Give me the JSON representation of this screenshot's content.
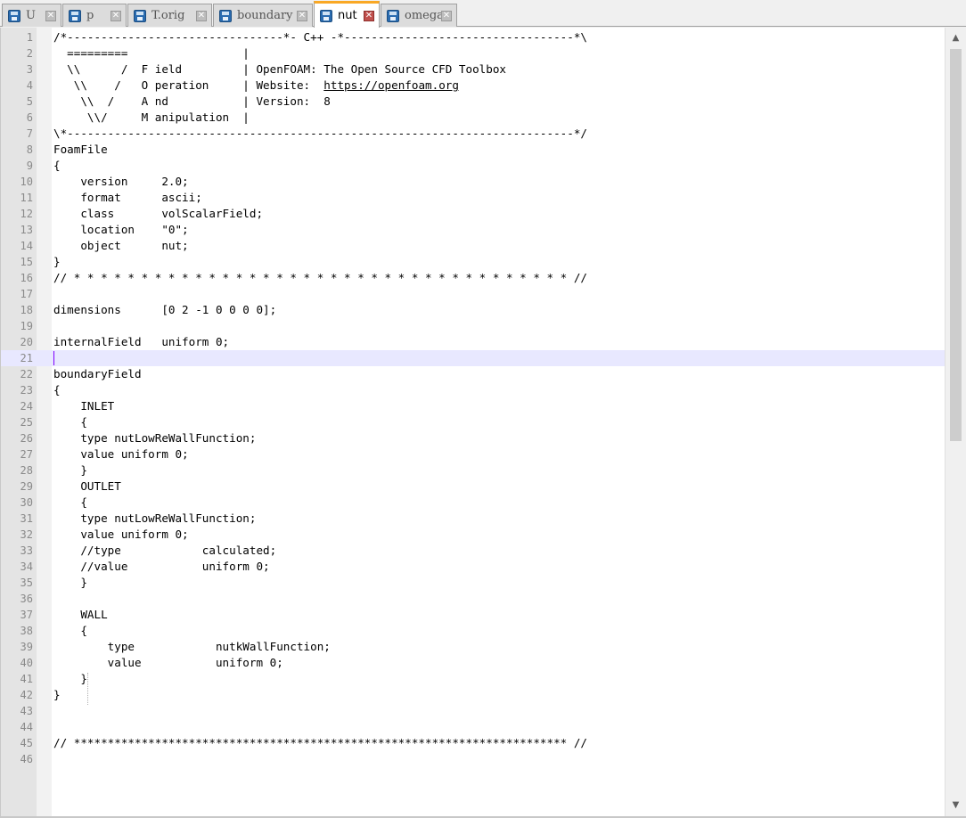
{
  "tabs": [
    {
      "label": "U",
      "active": false
    },
    {
      "label": "p",
      "active": false
    },
    {
      "label": "T.orig",
      "active": false
    },
    {
      "label": "boundary",
      "active": false
    },
    {
      "label": "nut",
      "active": true
    },
    {
      "label": "omega",
      "active": false
    }
  ],
  "icons": {
    "tab_icon": "save-icon",
    "tab_close": "close-icon",
    "scroll_up": "arrow-up-icon",
    "scroll_down": "arrow-down-icon"
  },
  "editor": {
    "current_line": 21,
    "lines": [
      "/*--------------------------------*- C++ -*----------------------------------*\\",
      "  =========                 |",
      "  \\\\      /  F ield         | OpenFOAM: The Open Source CFD Toolbox",
      "   \\\\    /   O peration     | Website:  https://openfoam.org",
      "    \\\\  /    A nd           | Version:  8",
      "     \\\\/     M anipulation  |",
      "\\*---------------------------------------------------------------------------*/",
      "FoamFile",
      "{",
      "    version     2.0;",
      "    format      ascii;",
      "    class       volScalarField;",
      "    location    \"0\";",
      "    object      nut;",
      "}",
      "// * * * * * * * * * * * * * * * * * * * * * * * * * * * * * * * * * * * * * //",
      "",
      "dimensions      [0 2 -1 0 0 0 0];",
      "",
      "internalField   uniform 0;",
      "",
      "boundaryField",
      "{",
      "    INLET",
      "    {",
      "    type nutLowReWallFunction;",
      "    value uniform 0;",
      "    }",
      "    OUTLET",
      "    {",
      "    type nutLowReWallFunction;",
      "    value uniform 0;",
      "    //type            calculated;",
      "    //value           uniform 0;",
      "    }",
      "",
      "    WALL",
      "    {",
      "        type            nutkWallFunction;",
      "        value           uniform 0;",
      "    }",
      "}",
      "",
      "",
      "// ************************************************************************* //",
      ""
    ]
  },
  "colors": {
    "active_tab_accent": "#f9a825",
    "current_line_bg": "#e8e8ff",
    "caret": "#8000ff",
    "gutter_bg": "#e4e4e4",
    "close_active": "#c0504d"
  }
}
